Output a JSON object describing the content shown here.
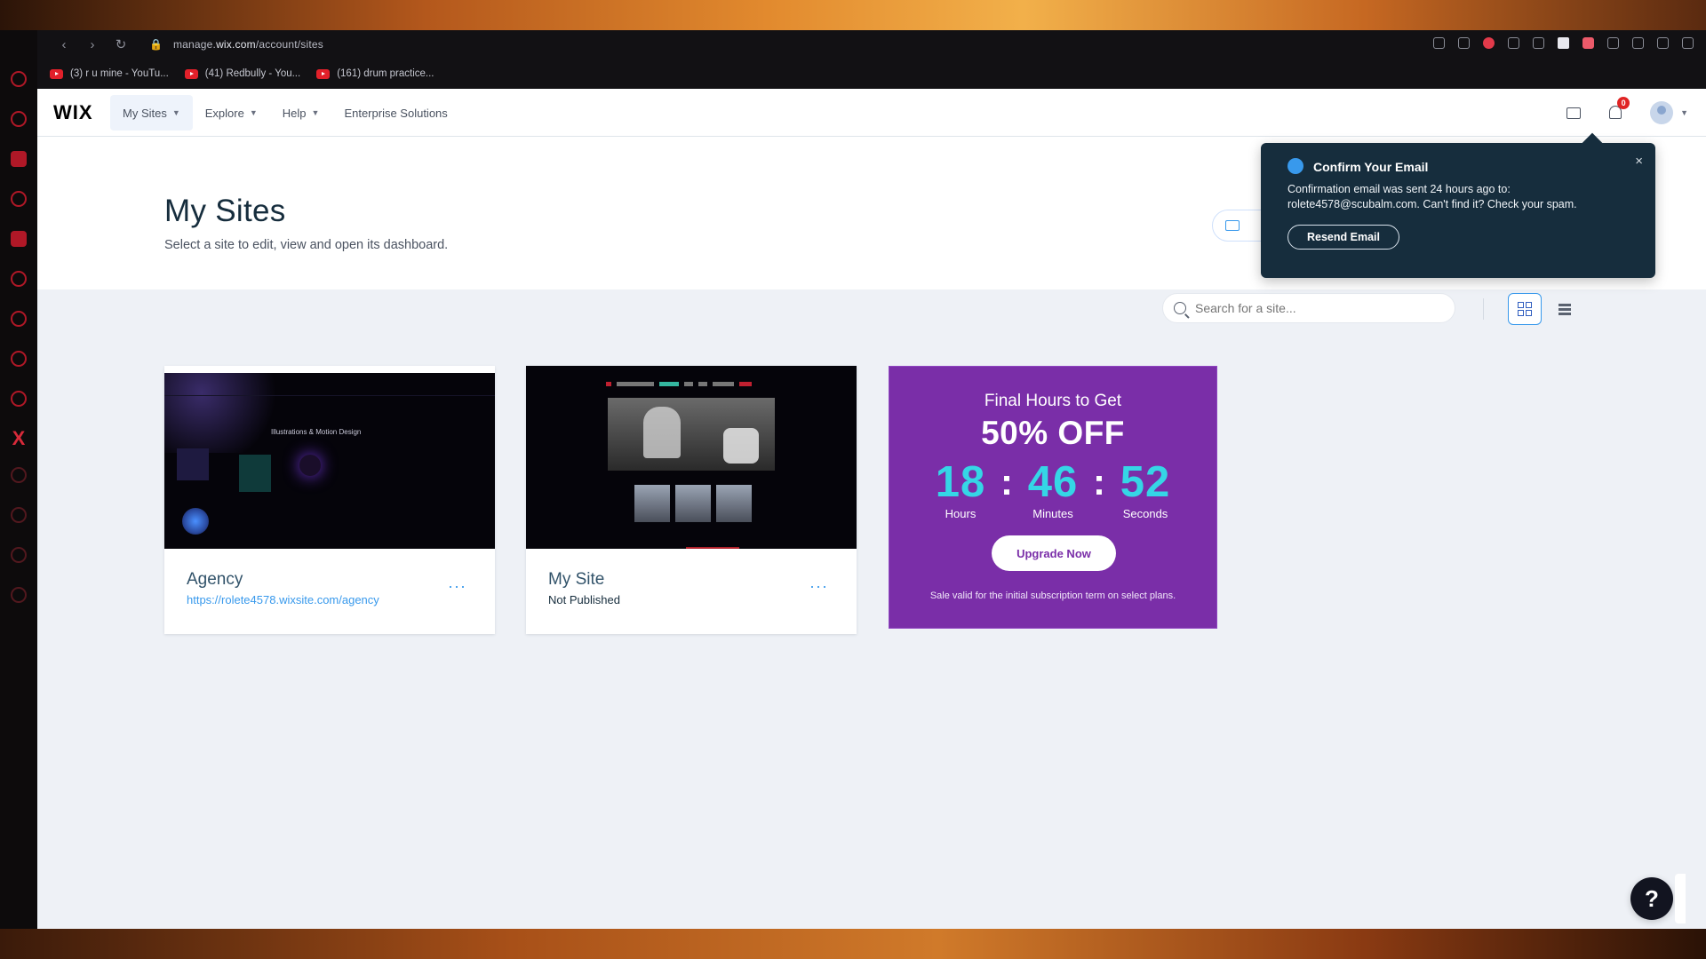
{
  "browser": {
    "url_prefix": "manage.",
    "url_domain": "wix.com",
    "url_path": "/account/sites",
    "bookmarks": [
      {
        "label": "(3) r u mine - YouTu..."
      },
      {
        "label": "(41) Redbully - You..."
      },
      {
        "label": "(161) drum practice..."
      }
    ]
  },
  "header": {
    "logo": "WIX",
    "nav": [
      {
        "label": "My Sites",
        "has_dropdown": true
      },
      {
        "label": "Explore",
        "has_dropdown": true
      },
      {
        "label": "Help",
        "has_dropdown": true
      },
      {
        "label": "Enterprise Solutions",
        "has_dropdown": false
      }
    ],
    "notification_count": "0"
  },
  "page": {
    "title": "My Sites",
    "subtitle": "Select a site to edit, view and open its dashboard."
  },
  "search": {
    "placeholder": "Search for a site..."
  },
  "sites": [
    {
      "name": "Agency",
      "url": "https://rolete4578.wixsite.com/agency",
      "thumb_title": "Illustrations & Motion Design"
    },
    {
      "name": "My Site",
      "status": "Not Published"
    }
  ],
  "promo": {
    "eyebrow": "Final Hours to Get",
    "headline": "50% OFF",
    "countdown": [
      {
        "value": "18",
        "label": "Hours"
      },
      {
        "value": "46",
        "label": "Minutes"
      },
      {
        "value": "52",
        "label": "Seconds"
      }
    ],
    "separator": ":",
    "button": "Upgrade Now",
    "fineprint": "Sale valid for the initial subscription term on select plans."
  },
  "email_popover": {
    "title": "Confirm Your Email",
    "body": "Confirmation email was sent 24 hours ago to: rolete4578@scubalm.com. Can't find it? Check your spam.",
    "button": "Resend Email",
    "close": "×"
  },
  "help": {
    "label": "?"
  },
  "colors": {
    "brand_blue": "#3899ec",
    "promo_purple": "#7a2ea8",
    "countdown_cyan": "#35d6e6",
    "popover_navy": "#162d3d"
  }
}
